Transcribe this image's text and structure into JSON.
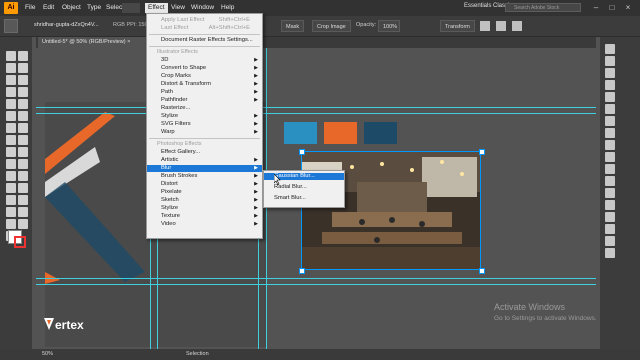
{
  "app": {
    "logo": "Ai"
  },
  "menubar": {
    "items": [
      "File",
      "Edit",
      "Object",
      "Type",
      "Select",
      "Effect",
      "View",
      "Window",
      "Help"
    ],
    "active": "Effect",
    "workspace": "Essentials Classic",
    "search_placeholder": "Search Adobe Stock"
  },
  "control_bar": {
    "filename": "shridhar-gupta-dZxQn4V...",
    "color_info": "RGB  PPI: 150",
    "mask_label": "Mask",
    "crop_label": "Crop Image",
    "opacity_label": "Opacity:",
    "opacity_value": "100%",
    "transform_label": "Transform"
  },
  "document_tab": {
    "title": "Untitled-5* @ 50% (RGB/Preview)",
    "close": "×"
  },
  "status_bar": {
    "zoom": "50%",
    "mode": "Selection"
  },
  "swatches": {
    "colors": [
      "#2a8fc1",
      "#e8682a",
      "#1d4a66"
    ]
  },
  "watermark": {
    "title": "Activate Windows",
    "subtitle": "Go to Settings to activate Windows."
  },
  "logo_text": "ertex",
  "effect_menu": {
    "apply_last": {
      "label": "Apply Last Effect",
      "shortcut": "Shift+Ctrl+E"
    },
    "last_effect": {
      "label": "Last Effect",
      "shortcut": "Alt+Shift+Ctrl+E"
    },
    "doc_raster": "Document Raster Effects Settings...",
    "illustrator_header": "Illustrator Effects",
    "illustrator_items": [
      "3D",
      "Convert to Shape",
      "Crop Marks",
      "Distort & Transform",
      "Path",
      "Pathfinder",
      "Rasterize...",
      "Stylize",
      "SVG Filters",
      "Warp"
    ],
    "photoshop_header": "Photoshop Effects",
    "photoshop_items": [
      "Effect Gallery...",
      "Artistic",
      "Blur",
      "Brush Strokes",
      "Distort",
      "Pixelate",
      "Sketch",
      "Stylize",
      "Texture",
      "Video"
    ],
    "highlighted": "Blur"
  },
  "blur_submenu": {
    "items": [
      "Gaussian Blur...",
      "Radial Blur...",
      "Smart Blur..."
    ],
    "highlighted": "Gaussian Blur..."
  }
}
